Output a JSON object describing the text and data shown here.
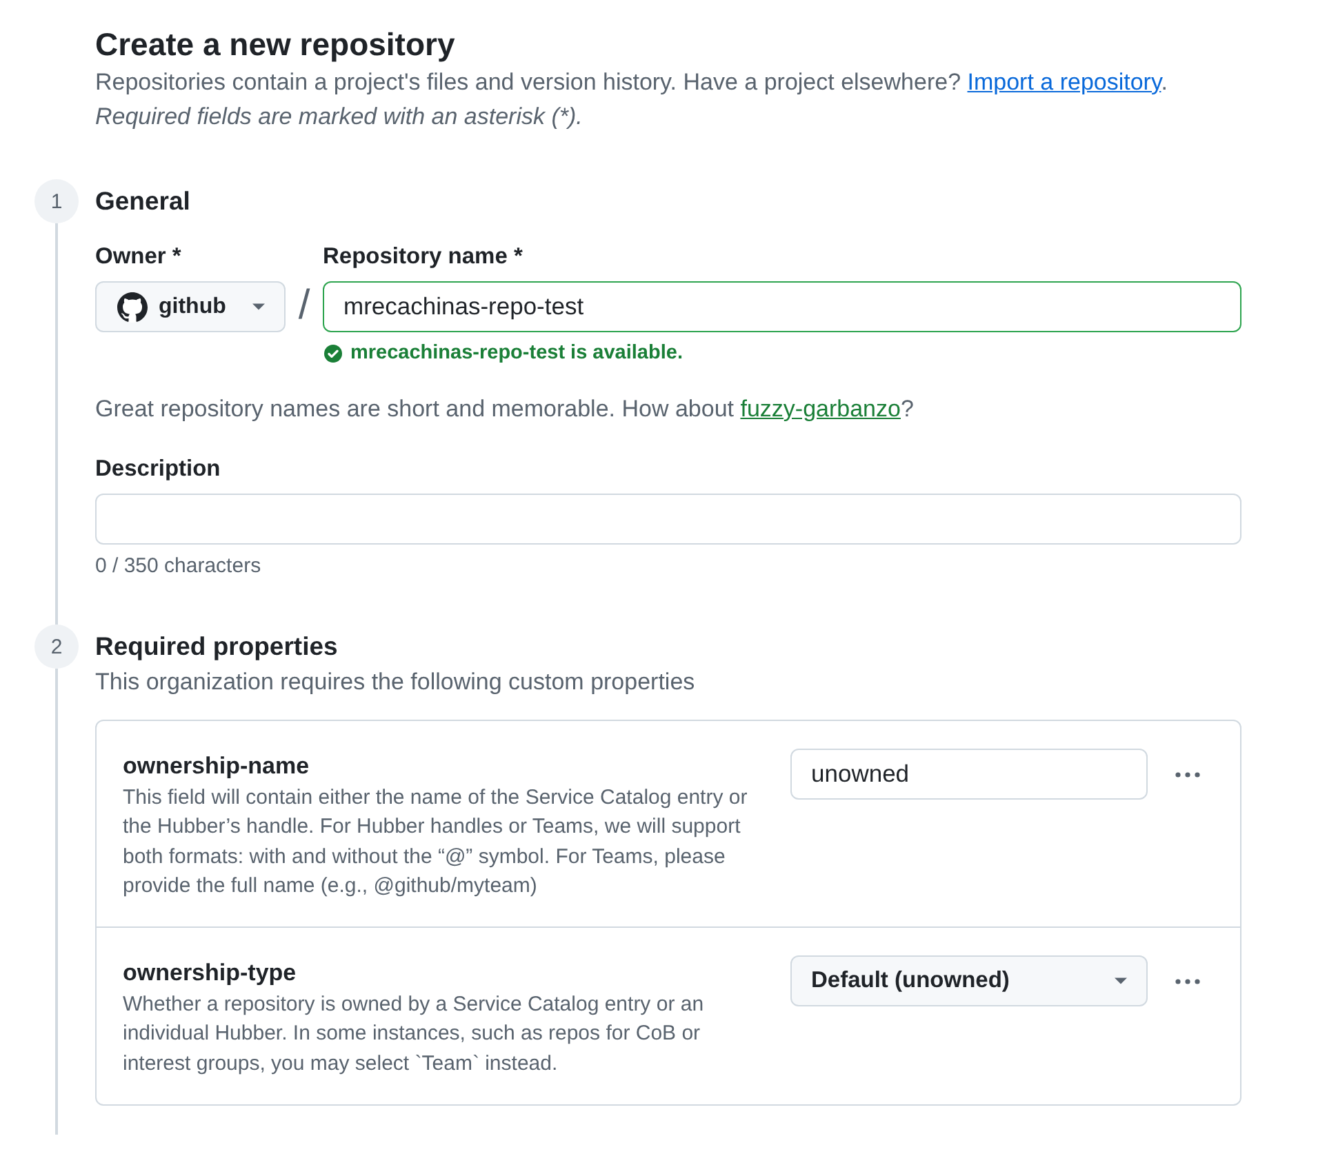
{
  "header": {
    "title": "Create a new repository",
    "intro": {
      "text": "Repositories contain a project's files and version history. Have a project elsewhere?",
      "link": "Import a repository",
      "after": "."
    },
    "required_note": "Required fields are marked with an asterisk (*)."
  },
  "general": {
    "step": "1",
    "title": "General",
    "owner": {
      "label": "Owner *",
      "value": "github"
    },
    "separator": "/",
    "repository_name": {
      "label": "Repository name *",
      "value": "mrecachinas-repo-test",
      "valid": true,
      "message": "mrecachinas-repo-test is available."
    },
    "suggestion": {
      "text": "Great repository names are short and memorable. How about",
      "link": "fuzzy-garbanzo",
      "after": "?"
    },
    "description": {
      "label": "Description",
      "counter": "0 / 350 characters"
    }
  },
  "required_properties": {
    "step": "2",
    "title": "Required properties",
    "subtitle": "This organization requires the following custom properties",
    "properties": [
      {
        "kind": "text",
        "name": "ownership-name",
        "description": "This field will contain either the name of the Service Catalog entry or the Hubber’s handle. For Hubber handles or Teams, we will support both formats: with and without the “@” symbol. For Teams, please provide the full name (e.g., @github/myteam)",
        "value": "unowned"
      },
      {
        "kind": "select",
        "name": "ownership-type",
        "description": "Whether a repository is owned by a Service Catalog entry or an individual Hubber. In some instances, such as repos for CoB or interest groups, you may select `Team` instead.",
        "value": "Default (unowned)"
      }
    ]
  }
}
